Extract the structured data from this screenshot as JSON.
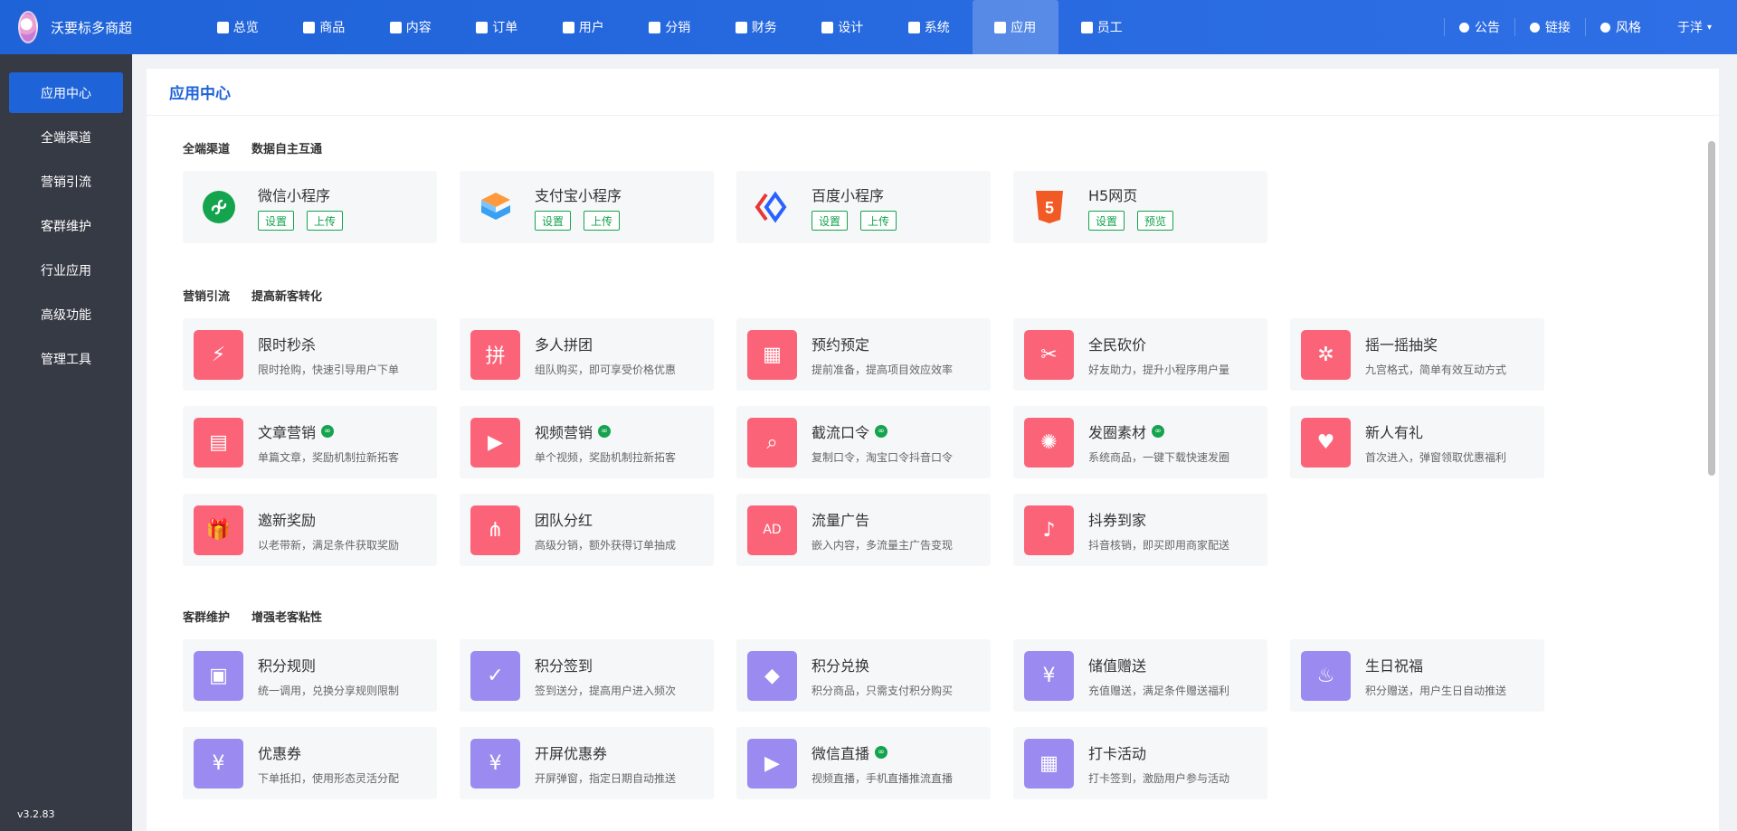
{
  "brand": {
    "name": "沃要标多商超"
  },
  "nav": {
    "items": [
      {
        "label": "总览",
        "icon": "home-icon"
      },
      {
        "label": "商品",
        "icon": "bag-icon"
      },
      {
        "label": "内容",
        "icon": "document-icon"
      },
      {
        "label": "订单",
        "icon": "clipboard-icon"
      },
      {
        "label": "用户",
        "icon": "user-icon"
      },
      {
        "label": "分销",
        "icon": "network-icon"
      },
      {
        "label": "财务",
        "icon": "money-bag-icon"
      },
      {
        "label": "设计",
        "icon": "brush-icon"
      },
      {
        "label": "系统",
        "icon": "gear-icon"
      },
      {
        "label": "应用",
        "icon": "apps-icon"
      },
      {
        "label": "员工",
        "icon": "lock-icon"
      }
    ],
    "active_index": 9
  },
  "topright": {
    "announce": "公告",
    "link": "链接",
    "style": "风格",
    "user": "于洋"
  },
  "sidebar": {
    "items": [
      {
        "label": "应用中心"
      },
      {
        "label": "全端渠道"
      },
      {
        "label": "营销引流"
      },
      {
        "label": "客群维护"
      },
      {
        "label": "行业应用"
      },
      {
        "label": "高级功能"
      },
      {
        "label": "管理工具"
      }
    ],
    "active_index": 0,
    "version": "v3.2.83"
  },
  "page": {
    "title": "应用中心"
  },
  "sections": {
    "channels": {
      "title": "全端渠道",
      "subtitle": "数据自主互通",
      "items": [
        {
          "name": "微信小程序",
          "btn1": "设置",
          "btn2": "上传",
          "icon": "wechat-miniprogram-icon"
        },
        {
          "name": "支付宝小程序",
          "btn1": "设置",
          "btn2": "上传",
          "icon": "alipay-miniprogram-icon"
        },
        {
          "name": "百度小程序",
          "btn1": "设置",
          "btn2": "上传",
          "icon": "baidu-miniprogram-icon"
        },
        {
          "name": "H5网页",
          "btn1": "设置",
          "btn2": "预览",
          "icon": "html5-icon"
        }
      ]
    },
    "marketing": {
      "title": "营销引流",
      "subtitle": "提高新客转化",
      "items": [
        {
          "name": "限时秒杀",
          "desc": "限时抢购，快速引导用户下单",
          "icon": "stopwatch-icon",
          "glyph": "⚡",
          "badge": false
        },
        {
          "name": "多人拼团",
          "desc": "组队购买，即可享受价格优惠",
          "icon": "group-buy-icon",
          "glyph": "拼",
          "badge": false
        },
        {
          "name": "预约预定",
          "desc": "提前准备，提高项目效应效率",
          "icon": "calendar-icon",
          "glyph": "▦",
          "badge": false
        },
        {
          "name": "全民砍价",
          "desc": "好友助力，提升小程序用户量",
          "icon": "scissors-tag-icon",
          "glyph": "✂",
          "badge": false
        },
        {
          "name": "摇一摇抽奖",
          "desc": "九宫格式，简单有效互动方式",
          "icon": "wheel-icon",
          "glyph": "✲",
          "badge": false
        },
        {
          "name": "文章营销",
          "desc": "单篇文章，奖励机制拉新拓客",
          "icon": "article-icon",
          "glyph": "▤",
          "badge": true
        },
        {
          "name": "视频营销",
          "desc": "单个视频，奖励机制拉新拓客",
          "icon": "video-play-icon",
          "glyph": "▶",
          "badge": true
        },
        {
          "name": "截流口令",
          "desc": "复制口令，淘宝口令抖音口令",
          "icon": "search-bubble-icon",
          "glyph": "⌕",
          "badge": true
        },
        {
          "name": "发圈素材",
          "desc": "系统商品，一键下载快速发圈",
          "icon": "aperture-icon",
          "glyph": "✺",
          "badge": true
        },
        {
          "name": "新人有礼",
          "desc": "首次进入，弹窗领取优惠福利",
          "icon": "heart-hand-icon",
          "glyph": "♥",
          "badge": false
        },
        {
          "name": "邀新奖励",
          "desc": "以老带新，满足条件获取奖励",
          "icon": "gift-icon",
          "glyph": "🎁",
          "badge": false
        },
        {
          "name": "团队分红",
          "desc": "高级分销，额外获得订单抽成",
          "icon": "share-nodes-icon",
          "glyph": "⋔",
          "badge": false
        },
        {
          "name": "流量广告",
          "desc": "嵌入内容，多流量主广告变现",
          "icon": "ad-icon",
          "glyph": "AD",
          "badge": false
        },
        {
          "name": "抖券到家",
          "desc": "抖音核销，即买即用商家配送",
          "icon": "douyin-ticket-icon",
          "glyph": "♪",
          "badge": false
        }
      ]
    },
    "retention": {
      "title": "客群维护",
      "subtitle": "增强老客粘性",
      "items": [
        {
          "name": "积分规则",
          "desc": "统一调用，兑换分享规则限制",
          "icon": "points-rule-icon",
          "glyph": "▣",
          "badge": false
        },
        {
          "name": "积分签到",
          "desc": "签到送分，提高用户进入频次",
          "icon": "checkin-calendar-icon",
          "glyph": "✓",
          "badge": false
        },
        {
          "name": "积分兑换",
          "desc": "积分商品，只需支付积分购买",
          "icon": "diamond-icon",
          "glyph": "◆",
          "badge": false
        },
        {
          "name": "储值赠送",
          "desc": "充值赠送，满足条件赠送福利",
          "icon": "money-bag-icon",
          "glyph": "¥",
          "badge": false
        },
        {
          "name": "生日祝福",
          "desc": "积分赠送，用户生日自动推送",
          "icon": "cake-icon",
          "glyph": "♨",
          "badge": false
        },
        {
          "name": "优惠券",
          "desc": "下单抵扣，使用形态灵活分配",
          "icon": "coupon-icon",
          "glyph": "¥",
          "badge": false
        },
        {
          "name": "开屏优惠券",
          "desc": "开屏弹窗，指定日期自动推送",
          "icon": "splash-coupon-icon",
          "glyph": "¥",
          "badge": false
        },
        {
          "name": "微信直播",
          "desc": "视频直播，手机直播推流直播",
          "icon": "live-camera-icon",
          "glyph": "▶",
          "badge": true
        },
        {
          "name": "打卡活动",
          "desc": "打卡签到，激励用户参与活动",
          "icon": "checkin-grid-icon",
          "glyph": "▦",
          "badge": false
        }
      ]
    }
  },
  "colors": {
    "primary": "#1f63d8",
    "sidebar_bg": "#363a45",
    "red_icon": "#fb6478",
    "purple_icon": "#9b8aef",
    "green": "#14a44d"
  }
}
